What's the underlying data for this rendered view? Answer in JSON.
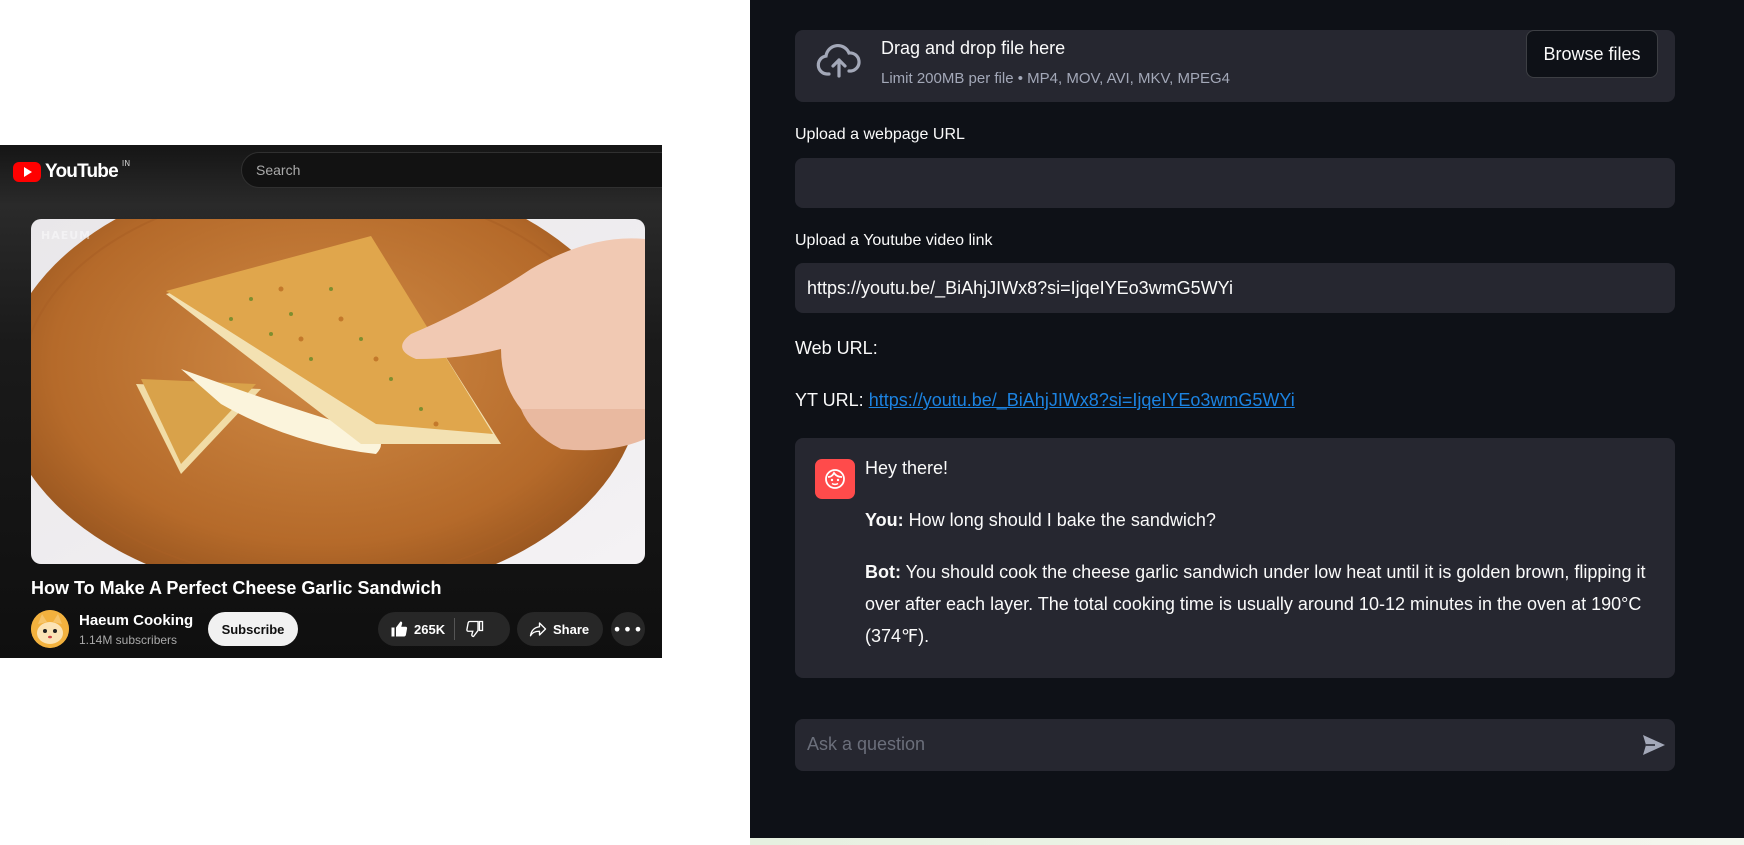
{
  "youtube": {
    "logo_text": "YouTube",
    "region": "IN",
    "search_placeholder": "Search",
    "thumbnail_watermark": "HAEUM",
    "video_title": "How To Make A Perfect Cheese Garlic Sandwich",
    "channel_name": "Haeum Cooking",
    "subscribers": "1.14M subscribers",
    "subscribe_label": "Subscribe",
    "like_count": "265K",
    "share_label": "Share"
  },
  "app": {
    "dropzone": {
      "title": "Drag and drop file here",
      "limit": "Limit 200MB per file • MP4, MOV, AVI, MKV, MPEG4",
      "browse_label": "Browse files"
    },
    "webpage_url_label": "Upload a webpage URL",
    "webpage_url_value": "",
    "youtube_link_label": "Upload a Youtube video link",
    "youtube_link_value": "https://youtu.be/_BiAhjJIWx8?si=IjqeIYEo3wmG5WYi",
    "web_url_text": "Web URL:",
    "yt_url_prefix": "YT URL:",
    "yt_url_link": "https://youtu.be/_BiAhjJIWx8?si=IjqeIYEo3wmG5WYi",
    "chat": {
      "greeting": "Hey there!",
      "user_prefix": "You:",
      "user_message": "How long should I bake the sandwich?",
      "bot_prefix": "Bot:",
      "bot_message": "You should cook the cheese garlic sandwich under low heat until it is golden brown, flipping it over after each layer. The total cooking time is usually around 10-12 minutes in the oven at 190°C (374℉)."
    },
    "ask_placeholder": "Ask a question"
  },
  "colors": {
    "youtube_red": "#ff0000",
    "app_background": "#0e1117",
    "widget_background": "#262730",
    "link_blue": "#1c83e1",
    "avatar_red": "#ff4b4b"
  },
  "icons": [
    "youtube-logo-icon",
    "upload-cloud-icon",
    "like-icon",
    "dislike-icon",
    "share-icon",
    "more-icon",
    "bot-avatar-icon",
    "send-icon"
  ]
}
